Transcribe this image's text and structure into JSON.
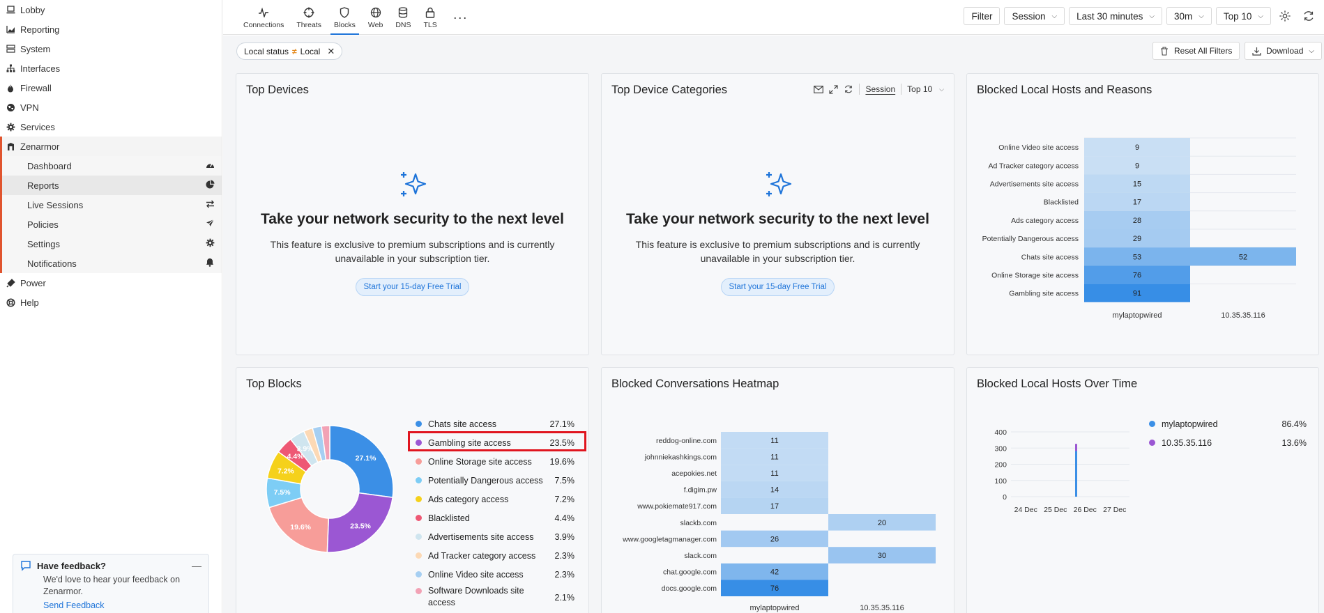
{
  "sidebar": {
    "items": [
      {
        "label": "Lobby",
        "icon": "laptop-icon"
      },
      {
        "label": "Reporting",
        "icon": "chart-area-icon"
      },
      {
        "label": "System",
        "icon": "server-icon"
      },
      {
        "label": "Interfaces",
        "icon": "sitemap-icon"
      },
      {
        "label": "Firewall",
        "icon": "fire-icon"
      },
      {
        "label": "VPN",
        "icon": "globe-icon"
      },
      {
        "label": "Services",
        "icon": "cog-icon"
      },
      {
        "label": "Zenarmor",
        "icon": "zenarmor-icon"
      }
    ],
    "sub_items": [
      {
        "label": "Dashboard",
        "icon": "dashboard-icon"
      },
      {
        "label": "Reports",
        "icon": "pie-chart-icon"
      },
      {
        "label": "Live Sessions",
        "icon": "exchange-icon"
      },
      {
        "label": "Policies",
        "icon": "plane-icon"
      },
      {
        "label": "Settings",
        "icon": "gear-icon"
      },
      {
        "label": "Notifications",
        "icon": "bell-icon"
      }
    ],
    "bottom_items": [
      {
        "label": "Power",
        "icon": "plug-icon"
      },
      {
        "label": "Help",
        "icon": "life-ring-icon"
      }
    ]
  },
  "feedback": {
    "title": "Have feedback?",
    "text": "We'd love to hear your feedback on Zenarmor.",
    "link": "Send Feedback"
  },
  "tabs": [
    {
      "label": "Connections"
    },
    {
      "label": "Threats"
    },
    {
      "label": "Blocks"
    },
    {
      "label": "Web"
    },
    {
      "label": "DNS"
    },
    {
      "label": "TLS"
    }
  ],
  "toolbar": {
    "filter": "Filter",
    "session": "Session",
    "range": "Last 30 minutes",
    "interval": "30m",
    "top": "Top 10"
  },
  "filters": {
    "chip_field": "Local status",
    "chip_op": "≠",
    "chip_value": "Local",
    "reset": "Reset All Filters",
    "download": "Download"
  },
  "premium": {
    "title": "Take your network security to the next level",
    "line1": "This feature is exclusive to premium subscriptions and is currently",
    "line2": "unavailable in your subscription tier.",
    "button": "Start your 15-day Free Trial"
  },
  "cards": {
    "top_devices": "Top Devices",
    "top_device_categories": "Top Device Categories",
    "blocked_hosts_reasons": "Blocked Local Hosts and Reasons",
    "top_blocks": "Top Blocks",
    "blocked_heatmap": "Blocked Conversations Heatmap",
    "blocked_over_time": "Blocked Local Hosts Over Time",
    "tools_session": "Session",
    "tools_top": "Top 10"
  },
  "chart_data": [
    {
      "type": "heatmap",
      "title": "Blocked Local Hosts and Reasons",
      "rows": [
        "Online Video site access",
        "Ad Tracker category access",
        "Advertisements site access",
        "Blacklisted",
        "Ads category access",
        "Potentially Dangerous access",
        "Chats site access",
        "Online Storage site access",
        "Gambling site access"
      ],
      "columns": [
        "mylaptopwired",
        "10.35.35.116"
      ],
      "values": [
        [
          9,
          null
        ],
        [
          9,
          null
        ],
        [
          15,
          null
        ],
        [
          17,
          null
        ],
        [
          28,
          null
        ],
        [
          29,
          null
        ],
        [
          53,
          52
        ],
        [
          76,
          null
        ],
        [
          91,
          null
        ]
      ]
    },
    {
      "type": "pie",
      "title": "Top Blocks",
      "labels": [
        "Chats site access",
        "Gambling site access",
        "Online Storage site access",
        "Potentially Dangerous access",
        "Ads category access",
        "Blacklisted",
        "Advertisements site access",
        "Ad Tracker category access",
        "Online Video site access",
        "Software Downloads site access"
      ],
      "values": [
        27.1,
        23.5,
        19.6,
        7.5,
        7.2,
        4.4,
        3.9,
        2.3,
        2.3,
        2.1
      ],
      "display": [
        "27.1%",
        "23.5%",
        "19.6%",
        "7.5%",
        "7.2%",
        "4.4%",
        "3.9%",
        "2.3%",
        "2.3%",
        "2.1%"
      ],
      "slice_labels": [
        "27.1%",
        "23.5%",
        "19.6%",
        "7.5%",
        "7.2%",
        "4.4%",
        "3.9%",
        "",
        "",
        ""
      ],
      "colors": [
        "#3b8fe6",
        "#9b57d3",
        "#f79d99",
        "#7dcdf5",
        "#f5d11b",
        "#ee5874",
        "#cfe5ef",
        "#fcd9b5",
        "#a6cff2",
        "#f2a2b5"
      ]
    },
    {
      "type": "heatmap",
      "title": "Blocked Conversations Heatmap",
      "rows": [
        "reddog-online.com",
        "johnniekashkings.com",
        "acepokies.net",
        "f.digim.pw",
        "www.pokiemate917.com",
        "slackb.com",
        "www.googletagmanager.com",
        "slack.com",
        "chat.google.com",
        "docs.google.com"
      ],
      "columns": [
        "mylaptopwired",
        "10.35.35.116"
      ],
      "values": [
        [
          11,
          null
        ],
        [
          11,
          null
        ],
        [
          11,
          null
        ],
        [
          14,
          null
        ],
        [
          17,
          null
        ],
        [
          null,
          20
        ],
        [
          26,
          null
        ],
        [
          null,
          30
        ],
        [
          42,
          null
        ],
        [
          76,
          null
        ]
      ]
    },
    {
      "type": "bar",
      "title": "Blocked Local Hosts Over Time",
      "x": [
        "24 Dec",
        "25 Dec",
        "26 Dec",
        "27 Dec"
      ],
      "ylim": [
        0,
        400
      ],
      "yticks": [
        0,
        100,
        200,
        300,
        400
      ],
      "series": [
        {
          "name": "mylaptopwired",
          "color": "#3b8fe6",
          "share": "86.4%",
          "values": [
            0,
            0,
            282,
            0
          ]
        },
        {
          "name": "10.35.35.116",
          "color": "#9b57d3",
          "share": "13.6%",
          "values": [
            0,
            0,
            44,
            0
          ]
        }
      ]
    }
  ]
}
